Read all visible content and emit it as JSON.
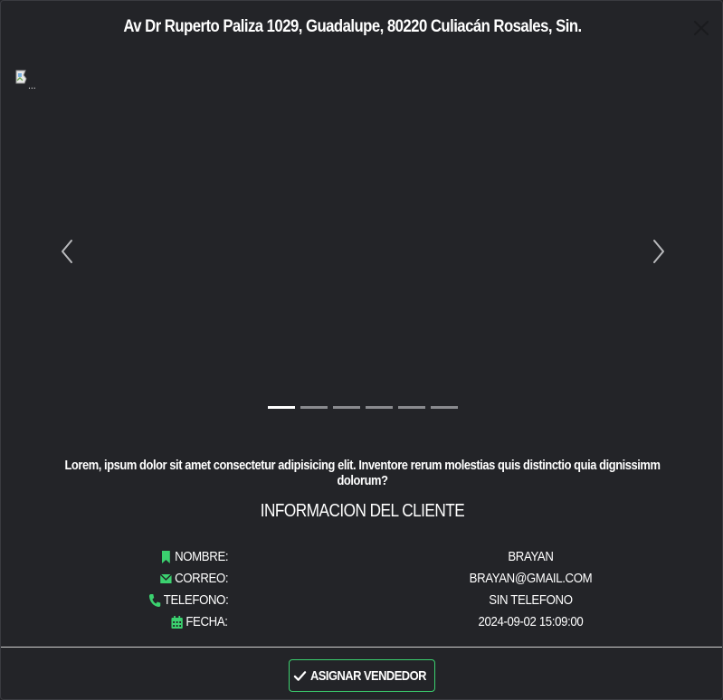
{
  "modal": {
    "title": "Av Dr Ruperto Paliza 1029, Guadalupe, 80220 Culiacán Rosales, Sin.",
    "close_icon": "close-icon"
  },
  "carousel": {
    "image_alt": "...",
    "prev_icon": "chevron-left-icon",
    "next_icon": "chevron-right-icon",
    "indicator_count": 6,
    "active_index": 0
  },
  "description": "Lorem, ipsum dolor sit amet consectetur adipisicing elit. Inventore rerum molestias quis distinctio quia dignissimm dolorum?",
  "client_info": {
    "title": "INFORMACION DEL CLIENTE",
    "rows": [
      {
        "icon": "bookmark-icon",
        "label": "NOMBRE:",
        "value": "BRAYAN"
      },
      {
        "icon": "envelope-icon",
        "label": "CORREO:",
        "value": "BRAYAN@GMAIL.COM"
      },
      {
        "icon": "phone-icon",
        "label": "TELEFONO:",
        "value": "SIN TELEFONO"
      },
      {
        "icon": "calendar-icon",
        "label": "FECHA:",
        "value": "2024-09-02 15:09:00"
      }
    ]
  },
  "footer": {
    "assign_label": "ASIGNAR VENDEDOR",
    "assign_icon": "check-icon"
  },
  "colors": {
    "background": "#232428",
    "accent": "#3bd16f",
    "text": "#ffffff"
  }
}
